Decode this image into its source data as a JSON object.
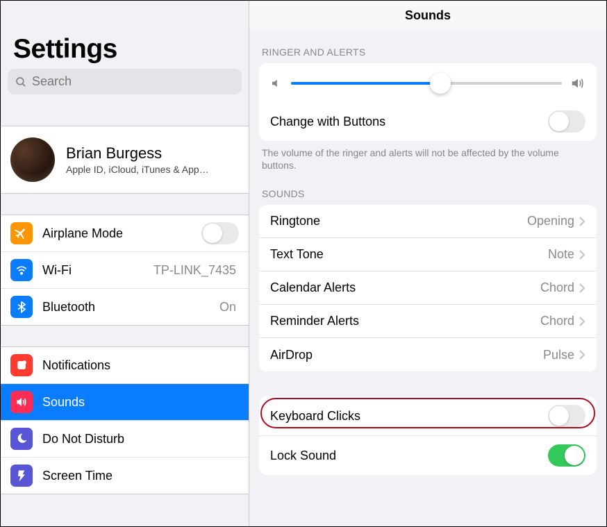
{
  "sidebar": {
    "title": "Settings",
    "search_placeholder": "Search",
    "account": {
      "name": "Brian Burgess",
      "subtitle": "Apple ID, iCloud, iTunes & App…"
    },
    "group1": [
      {
        "id": "airplane",
        "label": "Airplane Mode",
        "type": "toggle",
        "on": false,
        "icon_bg": "#ff9500"
      },
      {
        "id": "wifi",
        "label": "Wi-Fi",
        "value": "TP-LINK_7435",
        "icon_bg": "#0a7cff"
      },
      {
        "id": "bluetooth",
        "label": "Bluetooth",
        "value": "On",
        "icon_bg": "#0a7cff"
      }
    ],
    "group2": [
      {
        "id": "notifications",
        "label": "Notifications",
        "icon_bg": "#ff3b30"
      },
      {
        "id": "sounds",
        "label": "Sounds",
        "icon_bg": "#ff2d55",
        "selected": true
      },
      {
        "id": "dnd",
        "label": "Do Not Disturb",
        "icon_bg": "#5856d6"
      },
      {
        "id": "screentime",
        "label": "Screen Time",
        "icon_bg": "#5856d6"
      }
    ]
  },
  "detail": {
    "title": "Sounds",
    "ringer_header": "RINGER AND ALERTS",
    "slider_percent": 55,
    "change_with_buttons": {
      "label": "Change with Buttons",
      "on": false
    },
    "ringer_note": "The volume of the ringer and alerts will not be affected by the volume buttons.",
    "sounds_header": "SOUNDS",
    "sound_items": [
      {
        "label": "Ringtone",
        "value": "Opening"
      },
      {
        "label": "Text Tone",
        "value": "Note"
      },
      {
        "label": "Calendar Alerts",
        "value": "Chord"
      },
      {
        "label": "Reminder Alerts",
        "value": "Chord"
      },
      {
        "label": "AirDrop",
        "value": "Pulse"
      }
    ],
    "extra_toggles": [
      {
        "id": "keyboard_clicks",
        "label": "Keyboard Clicks",
        "on": false,
        "highlighted": true
      },
      {
        "id": "lock_sound",
        "label": "Lock Sound",
        "on": true
      }
    ]
  }
}
